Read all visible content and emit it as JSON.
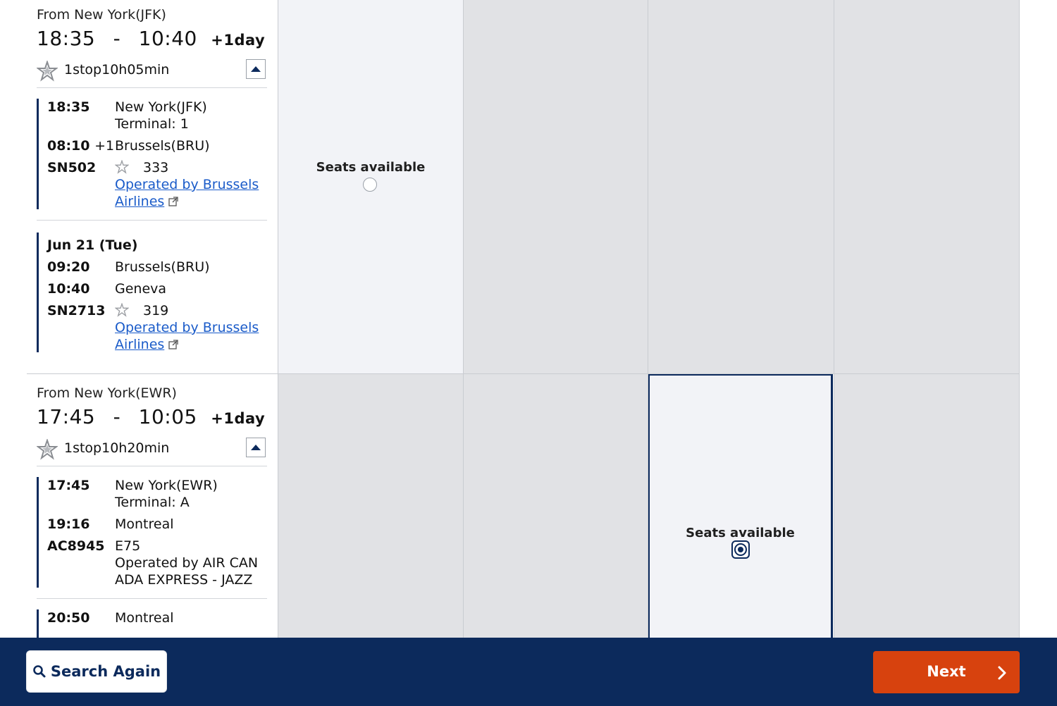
{
  "flights": [
    {
      "from_label": "From New York(JFK)",
      "depart": "18:35",
      "arrive": "10:40",
      "day_offset": "+1day",
      "summary": "1stop10h05min",
      "segments": [
        {
          "dep_time": "18:35",
          "dep_place": "New York(JFK)",
          "terminal": "Terminal: 1",
          "arr_time": "08:10",
          "arr_offset": "+1",
          "arr_place": "Brussels(BRU)",
          "flight_no": "SN502",
          "aircraft": "333",
          "operated_line1": "Operated by Brussels",
          "operated_line2": "Airlines"
        },
        {
          "date": "Jun 21 (Tue)",
          "dep_time": "09:20",
          "dep_place": "Brussels(BRU)",
          "arr_time": "10:40",
          "arr_place": "Geneva",
          "flight_no": "SN2713",
          "aircraft": "319",
          "operated_line1": "Operated by Brussels",
          "operated_line2": "Airlines"
        }
      ],
      "fare_cells": [
        {
          "status": "Seats available",
          "selected": false
        },
        {
          "status": "",
          "selected": false
        },
        {
          "status": "",
          "selected": false
        },
        {
          "status": "",
          "selected": false
        }
      ]
    },
    {
      "from_label": "From New York(EWR)",
      "depart": "17:45",
      "arrive": "10:05",
      "day_offset": "+1day",
      "summary": "1stop10h20min",
      "segments": [
        {
          "dep_time": "17:45",
          "dep_place": "New York(EWR)",
          "terminal": "Terminal: A",
          "arr_time": "19:16",
          "arr_place": "Montreal",
          "flight_no": "AC8945",
          "aircraft": "E75",
          "operated_line1": "Operated by AIR CAN",
          "operated_line2": "ADA EXPRESS - JAZZ"
        },
        {
          "dep_time": "20:50",
          "dep_place": "Montreal"
        }
      ],
      "fare_cells": [
        {
          "status": "",
          "selected": false
        },
        {
          "status": "",
          "selected": false
        },
        {
          "status": "Seats available",
          "selected": true
        },
        {
          "status": "",
          "selected": false
        }
      ]
    }
  ],
  "footer": {
    "search_again_label": "Search Again",
    "next_label": "Next"
  },
  "colors": {
    "navy": "#0c2a5c",
    "next_button": "#d7420e",
    "link": "#1a5bc9",
    "cell_light": "#f2f3f7",
    "cell_gray": "#e1e2e5"
  }
}
